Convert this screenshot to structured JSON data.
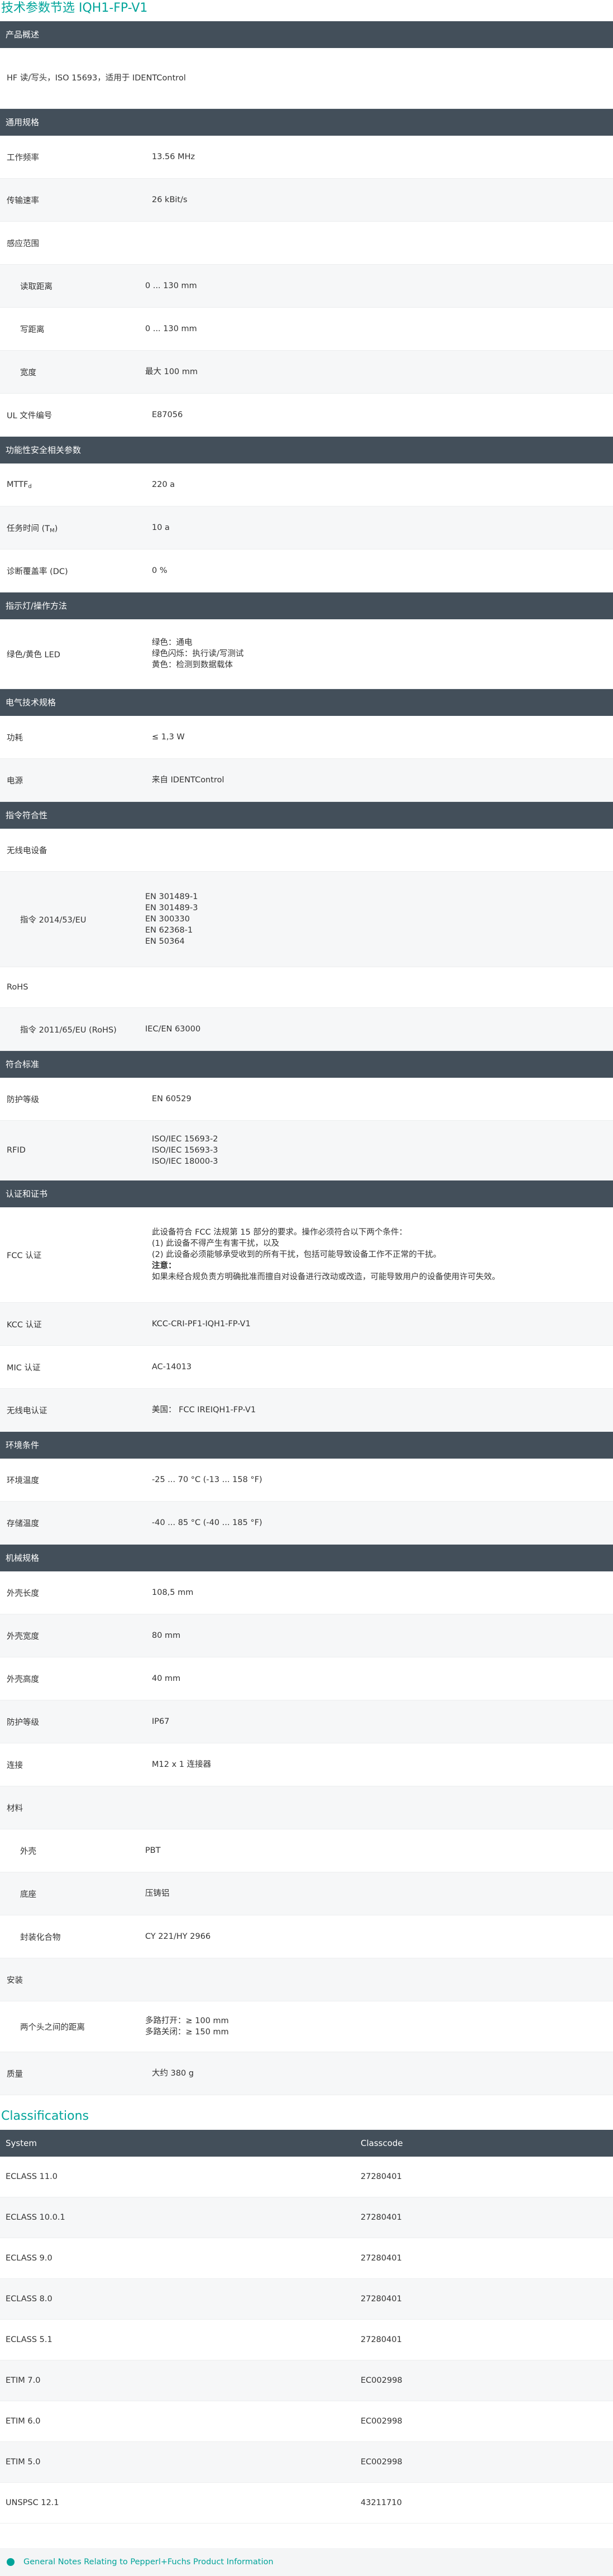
{
  "page_title": "技术参数节选  IQH1-FP-V1",
  "sections": [
    {
      "title": "产品概述",
      "rows": [
        {
          "label": "",
          "value": [
            "HF 读/写头，ISO 15693，适用于 IDENTControl"
          ],
          "h": 108,
          "full": true
        }
      ]
    },
    {
      "title": "通用规格",
      "gap": 26,
      "rows": [
        {
          "label": "工作频率",
          "value": [
            "13.56 MHz"
          ],
          "h": 76
        },
        {
          "label": "传输速率",
          "value": [
            "26 kBit/s"
          ],
          "h": 76,
          "alt": true
        },
        {
          "label": "感应范围",
          "value": [],
          "h": 76
        },
        {
          "label": "读取距离",
          "value": [
            "0 ... 130 mm"
          ],
          "h": 76,
          "indent": true,
          "alt": true
        },
        {
          "label": "写距离",
          "value": [
            "0 ... 130 mm"
          ],
          "h": 76,
          "indent": true
        },
        {
          "label": "宽度",
          "value": [
            "最大 100 mm"
          ],
          "h": 76,
          "indent": true,
          "alt": true
        },
        {
          "label": "UL 文件编号",
          "value": [
            "E87056"
          ],
          "h": 76
        }
      ]
    },
    {
      "title": "功能性安全相关参数",
      "rows": [
        {
          "label": "MTTFd",
          "value": [
            "220 a"
          ],
          "h": 76,
          "sub": "d"
        },
        {
          "label": "任务时间 (TM)",
          "value": [
            "10 a"
          ],
          "h": 76,
          "alt": true
        },
        {
          "label": "诊断覆盖率 (DC)",
          "value": [
            "0 %"
          ],
          "h": 76
        }
      ]
    },
    {
      "title": "指示灯/操作方法",
      "rows": [
        {
          "label": "绿色/黄色 LED",
          "value": [
            "绿色：通电",
            "绿色闪烁：执行读/写测试",
            "黄色：检测到数据载体"
          ],
          "h": 124
        }
      ]
    },
    {
      "title": "电气技术规格",
      "rows": [
        {
          "label": "功耗",
          "value": [
            "≤ 1,3 W"
          ],
          "h": 76
        },
        {
          "label": "电源",
          "value": [
            "来自 IDENTControl"
          ],
          "h": 76,
          "alt": true
        }
      ]
    },
    {
      "title": "指令符合性",
      "rows": [
        {
          "label": "无线电设备",
          "value": [],
          "h": 76
        },
        {
          "label": "指令 2014/53/EU",
          "value": [
            "EN 301489-1",
            "EN 301489-3",
            "EN 300330",
            "EN 62368-1",
            "EN 50364"
          ],
          "h": 170,
          "indent": true,
          "alt": true
        },
        {
          "label": "RoHS",
          "value": [],
          "h": 72
        },
        {
          "label": "指令 2011/65/EU (RoHS)",
          "value": [
            "IEC/EN 63000"
          ],
          "h": 76,
          "indent": true,
          "alt": true
        }
      ]
    },
    {
      "title": "符合标准",
      "rows": [
        {
          "label": "防护等级",
          "value": [
            "EN 60529"
          ],
          "h": 76
        },
        {
          "label": "RFID",
          "value": [
            "ISO/IEC 15693-2",
            "ISO/IEC 15693-3",
            "ISO/IEC 18000-3"
          ],
          "h": 106,
          "alt": true
        }
      ]
    },
    {
      "title": "认证和证书",
      "rows": [
        {
          "label": "FCC 认证",
          "value": [
            "此设备符合 FCC 法规第 15 部分的要求。操作必须符合以下两个条件：",
            "(1) 此设备不得产生有害干扰，以及",
            "(2) 此设备必须能够承受收到的所有干扰，包括可能导致设备工作不正常的干扰。",
            "注意：",
            "如果未经合规负责方明确批准而擅自对设备进行改动或改造，可能导致用户的设备使用许可失效。"
          ],
          "h": 170,
          "boldLine": 3
        },
        {
          "label": "KCC 认证",
          "value": [
            "KCC-CRI-PF1-IQH1-FP-V1"
          ],
          "h": 76,
          "alt": true
        },
        {
          "label": "MIC 认证",
          "value": [
            "AC-14013"
          ],
          "h": 76
        },
        {
          "label": "无线电认证",
          "value": [
            "美国： FCC IREIQH1-FP-V1"
          ],
          "h": 76,
          "alt": true
        }
      ]
    },
    {
      "title": "环境条件",
      "rows": [
        {
          "label": "环境温度",
          "value": [
            "-25 ... 70 °C (-13 ... 158 °F)"
          ],
          "h": 76
        },
        {
          "label": "存储温度",
          "value": [
            "-40 ... 85 °C (-40 ... 185 °F)"
          ],
          "h": 76,
          "alt": true
        }
      ]
    },
    {
      "title": "机械规格",
      "rows": [
        {
          "label": "外壳长度",
          "value": [
            "108,5 mm"
          ],
          "h": 76
        },
        {
          "label": "外壳宽度",
          "value": [
            "80 mm"
          ],
          "h": 76,
          "alt": true
        },
        {
          "label": "外壳高度",
          "value": [
            "40 mm"
          ],
          "h": 76
        },
        {
          "label": "防护等级",
          "value": [
            "IP67"
          ],
          "h": 76,
          "alt": true
        },
        {
          "label": "连接",
          "value": [
            "M12 x 1 连接器"
          ],
          "h": 76
        },
        {
          "label": "材料",
          "value": [],
          "h": 76,
          "alt": true
        },
        {
          "label": "外壳",
          "value": [
            "PBT"
          ],
          "h": 76,
          "indent": true
        },
        {
          "label": "底座",
          "value": [
            "压铸铝"
          ],
          "h": 76,
          "indent": true,
          "alt": true
        },
        {
          "label": "封装化合物",
          "value": [
            "CY 221/HY 2966"
          ],
          "h": 76,
          "indent": true
        },
        {
          "label": "安装",
          "value": [],
          "h": 76,
          "alt": true
        },
        {
          "label": "两个头之间的距离",
          "value": [
            "多路打开：≥ 100 mm",
            "多路关闭：≥ 150 mm"
          ],
          "h": 90,
          "indent": true
        },
        {
          "label": "质量",
          "value": [
            "大约 380 g"
          ],
          "h": 76,
          "alt": true
        }
      ]
    }
  ],
  "classifications": {
    "title": "Classifications",
    "col_system": "System",
    "col_classcode": "Classcode",
    "rows": [
      {
        "system": "ECLASS 11.0",
        "code": "27280401"
      },
      {
        "system": "ECLASS 10.0.1",
        "code": "27280401"
      },
      {
        "system": "ECLASS 9.0",
        "code": "27280401"
      },
      {
        "system": "ECLASS 8.0",
        "code": "27280401"
      },
      {
        "system": "ECLASS 5.1",
        "code": "27280401"
      },
      {
        "system": "ETIM 7.0",
        "code": "EC002998"
      },
      {
        "system": "ETIM 6.0",
        "code": "EC002998"
      },
      {
        "system": "ETIM 5.0",
        "code": "EC002998"
      },
      {
        "system": "UNSPSC 12.1",
        "code": "43211710"
      }
    ]
  },
  "notes_link": "General Notes Relating to Pepperl+Fuchs Product Information"
}
